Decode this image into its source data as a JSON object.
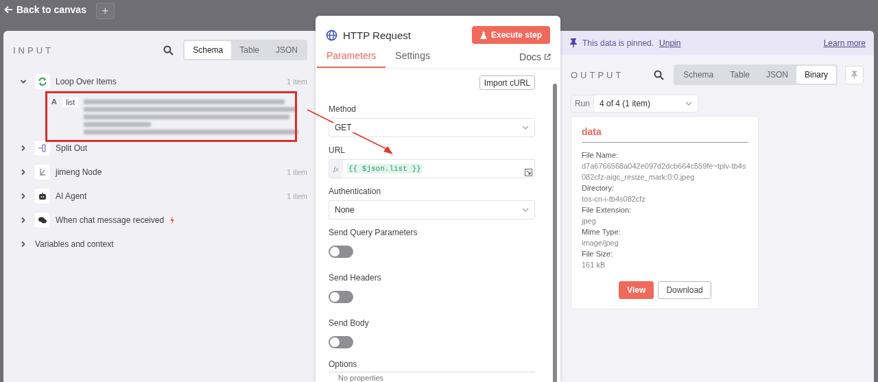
{
  "topbar": {
    "back_label": "Back to canvas",
    "add_button": "+"
  },
  "input": {
    "title": "INPUT",
    "view_tabs": [
      {
        "label": "Schema",
        "selected": true
      },
      {
        "label": "Table",
        "selected": false
      },
      {
        "label": "JSON",
        "selected": false
      }
    ],
    "nodes": [
      {
        "kind": "loop",
        "name": "Loop Over Items",
        "count": "1 item",
        "expanded": true,
        "fields": [
          {
            "type_marker": "A",
            "name": "list"
          }
        ]
      },
      {
        "kind": "split",
        "name": "Split Out",
        "expanded": false
      },
      {
        "kind": "custom",
        "name": "jimeng Node",
        "count": "1 item",
        "expanded": false
      },
      {
        "kind": "agent",
        "name": "AI Agent",
        "count": "1 item",
        "expanded": false
      },
      {
        "kind": "trigger",
        "name": "When chat message received",
        "expanded": false
      }
    ],
    "variables": {
      "label": "Variables and context",
      "expanded": false
    }
  },
  "node": {
    "title": "HTTP Request",
    "execute_button": "Execute step",
    "tabs": [
      {
        "label": "Parameters",
        "selected": true
      },
      {
        "label": "Settings",
        "selected": false
      }
    ],
    "docs_link": "Docs",
    "import_button": "Import cURL",
    "fields": [
      {
        "kind": "select",
        "label": "Method",
        "value": "GET"
      },
      {
        "kind": "expression",
        "label": "URL",
        "prefix": "fx",
        "value": "{{ $json.list }}"
      },
      {
        "kind": "select",
        "label": "Authentication",
        "value": "None"
      },
      {
        "kind": "toggle",
        "label": "Send Query Parameters",
        "on": false
      },
      {
        "kind": "toggle",
        "label": "Send Headers",
        "on": false
      },
      {
        "kind": "toggle",
        "label": "Send Body",
        "on": false
      }
    ],
    "options": {
      "label": "Options",
      "empty_text": "No properties"
    }
  },
  "output": {
    "banner": {
      "text": "This data is pinned.",
      "link": "Unpin",
      "learn_more": "Learn more"
    },
    "title": "OUTPUT",
    "view_tabs": [
      {
        "label": "Schema",
        "selected": false
      },
      {
        "label": "Table",
        "selected": false
      },
      {
        "label": "JSON",
        "selected": false
      },
      {
        "label": "Binary",
        "selected": true
      }
    ],
    "run": {
      "label": "Run",
      "value": "4 of 4 (1 item)"
    },
    "card": {
      "title": "data",
      "fields": [
        {
          "label": "File Name:",
          "value": "d7a6766568a042e097d2dcb664c559fe~tplv-tb4s082cfz-aigc_resize_mark:0:0.jpeg"
        },
        {
          "label": "Directory:",
          "value": "tos-cn-i-tb4s082cfz"
        },
        {
          "label": "File Extension:",
          "value": "jpeg"
        },
        {
          "label": "Mime Type:",
          "value": "image/jpeg"
        },
        {
          "label": "File Size:",
          "value": "161 kB"
        }
      ],
      "buttons": [
        {
          "kind": "primary",
          "label": "View"
        },
        {
          "kind": "secondary",
          "label": "Download"
        }
      ]
    }
  }
}
